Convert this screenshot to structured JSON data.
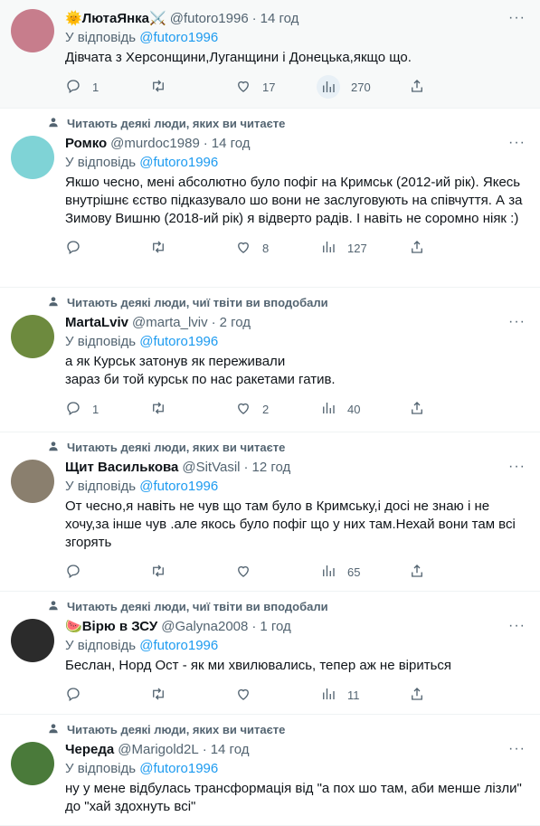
{
  "reply_prefix": "У відповідь",
  "tweets": [
    {
      "social": "",
      "name": "ЛютаЯнка",
      "name_prefix": "🌞",
      "name_suffix": "⚔️",
      "handle": "@futoro1996",
      "time": "14 год",
      "reply_to": "@futoro1996",
      "text": "Дівчата з Херсонщини,Луганщини і Донецька,якщо що.",
      "replies": "1",
      "retweets": "",
      "likes": "17",
      "views": "270",
      "avatar_color": "#c77d8c"
    },
    {
      "social": "Читають деякі люди, яких ви читаєте",
      "name": "Ромко",
      "name_prefix": "",
      "name_suffix": "",
      "handle": "@murdoc1989",
      "time": "14 год",
      "reply_to": "@futoro1996",
      "text": "Якшо чесно, мені абсолютно було пофіг на Кримськ (2012-ий рік). Якесь внутрішнє єство підказувало шо вони не заслуговують на співчуття. А за Зимову Вишню (2018-ий рік) я відверто радів. І навіть не соромно ніяк :)",
      "replies": "",
      "retweets": "",
      "likes": "8",
      "views": "127",
      "avatar_color": "#7fd3d6"
    },
    {
      "social": "Читають деякі люди, чиї твіти ви вподобали",
      "name": "MartaLviv",
      "name_prefix": "",
      "name_suffix": "",
      "handle": "@marta_lviv",
      "time": "2 год",
      "reply_to": "@futoro1996",
      "text": "а як Курськ затонув як переживали\nзараз би той курськ по нас ракетами гатив.",
      "replies": "1",
      "retweets": "",
      "likes": "2",
      "views": "40",
      "avatar_color": "#6d8a3e"
    },
    {
      "social": "Читають деякі люди, яких ви читаєте",
      "name": "Щит Василькова",
      "name_prefix": "",
      "name_suffix": "",
      "handle": "@SitVasil",
      "time": "12 год",
      "reply_to": "@futoro1996",
      "text": "От чесно,я навіть не чув що там було в Кримську,і досі не знаю і не хочу,за інше чув .але якось було пофіг що у них там.Нехай вони там всі згорять",
      "replies": "",
      "retweets": "",
      "likes": "",
      "views": "65",
      "avatar_color": "#8a7f6e"
    },
    {
      "social": "Читають деякі люди, чиї твіти ви вподобали",
      "name": "Вірю в ЗСУ",
      "name_prefix": "🍉",
      "name_suffix": "",
      "handle": "@Galyna2008",
      "time": "1 год",
      "reply_to": "@futoro1996",
      "text": "Беслан, Норд Ост - як ми хвилювались, тепер аж не віриться",
      "replies": "",
      "retweets": "",
      "likes": "",
      "views": "11",
      "avatar_color": "#2b2b2b"
    },
    {
      "social": "Читають деякі люди, яких ви читаєте",
      "name": "Череда",
      "name_prefix": "",
      "name_suffix": "",
      "handle": "@Marigold2L",
      "time": "14 год",
      "reply_to": "@futoro1996",
      "text": "ну у мене відбулась трансформація від \"а пох шо там, аби менше лізли\" до \"хай здохнуть всі\"",
      "replies": "",
      "retweets": "",
      "likes": "",
      "views": "",
      "avatar_color": "#4a7a3a"
    }
  ]
}
